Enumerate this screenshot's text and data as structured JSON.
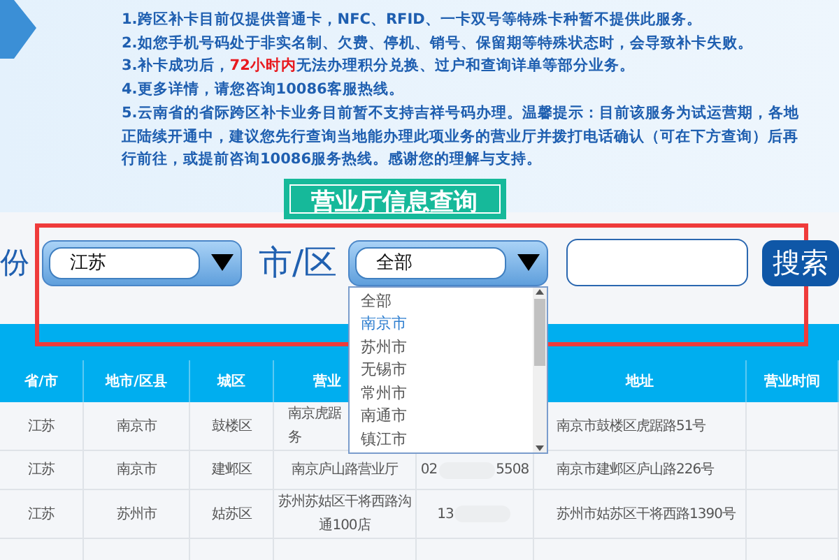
{
  "notice": {
    "lines": [
      "1.跨区补卡目前仅提供普通卡，NFC、RFID、一卡双号等特殊卡种暂不提供此服务。",
      "2.如您手机号码处于非实名制、欠费、停机、销号、保留期等特殊状态时，会导致补卡失败。",
      "3.补卡成功后，**72小时内**无法办理积分兑换、过户和查询详单等部分业务。",
      "4.更多详情，请您咨询10086客服热线。",
      "5.云南省的省际跨区补卡业务目前暂不支持吉祥号码办理。温馨提示：目前该服务为试运营期，各地",
      "正陆续开通中，建议您先行查询当地能办理此项业务的营业厅并拨打电话确认（可在下方查询）后再",
      "行前往，或提前咨询10086服务热线。感谢您的理解与支持。"
    ]
  },
  "query_button": "营业厅信息查询",
  "filters": {
    "province_label": "份",
    "province_value": "江苏",
    "city_label": "市/区",
    "city_value": "全部",
    "search_button": "搜索"
  },
  "city_dropdown": {
    "expanded": true,
    "options": [
      {
        "label": "全部",
        "selected": false
      },
      {
        "label": "南京市",
        "selected": true
      },
      {
        "label": "苏州市",
        "selected": false
      },
      {
        "label": "无锡市",
        "selected": false
      },
      {
        "label": "常州市",
        "selected": false
      },
      {
        "label": "南通市",
        "selected": false
      },
      {
        "label": "镇江市",
        "selected": false
      }
    ]
  },
  "table": {
    "columns": [
      "省/市",
      "地市/区县",
      "城区",
      "营业",
      null,
      "地址",
      "营业时间"
    ],
    "rows": [
      [
        [
          "江苏"
        ],
        [
          "南京市"
        ],
        [
          "鼓楼区"
        ],
        [
          "南京虎踞",
          "务"
        ],
        null,
        [
          "南京市鼓楼区虎踞路51号"
        ],
        null
      ],
      [
        [
          "江苏"
        ],
        [
          "南京市"
        ],
        [
          "建邺区"
        ],
        [
          "南京庐山路营业厅"
        ],
        {
          "kind": "redacted",
          "start": "02",
          "end": "5508"
        },
        [
          "南京市建邺区庐山路226号"
        ],
        null
      ],
      [
        [
          "江苏"
        ],
        [
          "苏州市"
        ],
        [
          "姑苏区"
        ],
        [
          "苏州苏姑区干将西路沟",
          "通100店"
        ],
        {
          "kind": "redacted",
          "start": "13"
        },
        [
          "苏州市姑苏区干将西路1390号"
        ],
        null
      ]
    ]
  }
}
